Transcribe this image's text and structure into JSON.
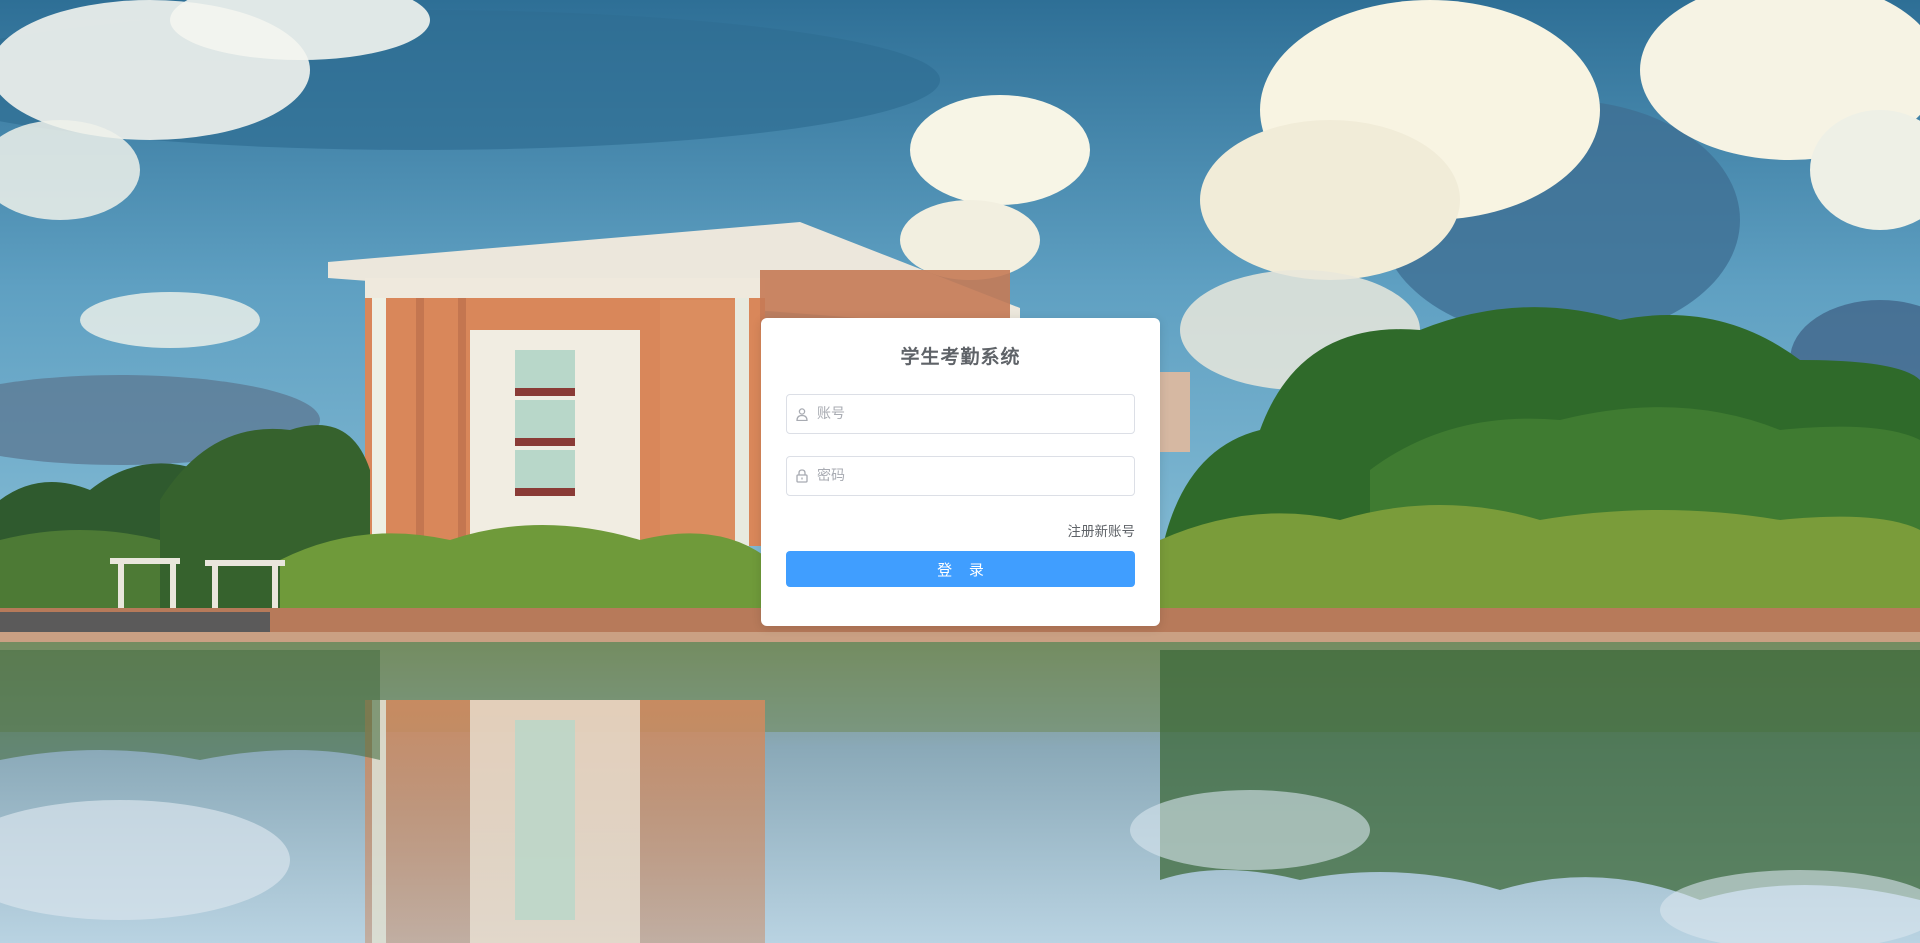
{
  "login": {
    "title": "学生考勤系统",
    "username_placeholder": "账号",
    "password_placeholder": "密码",
    "register_link": "注册新账号",
    "login_button": "登 录"
  },
  "icons": {
    "username": "user-icon",
    "password": "lock-icon"
  },
  "colors": {
    "primary_button": "#409eff",
    "card_background": "#ffffff",
    "title_text": "#5f6368"
  }
}
